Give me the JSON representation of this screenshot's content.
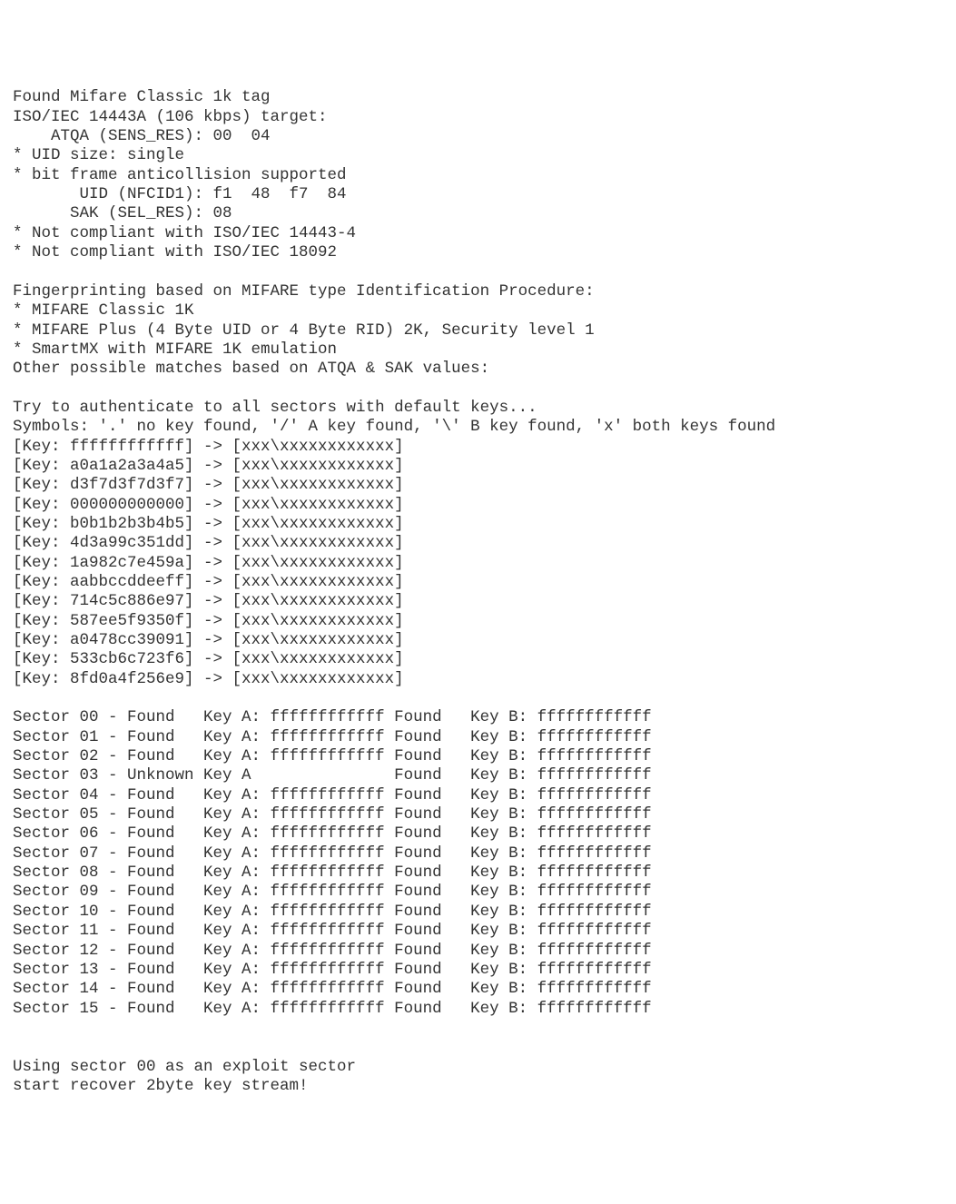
{
  "header": {
    "found_line": "Found Mifare Classic 1k tag",
    "iso_target": "ISO/IEC 14443A (106 kbps) target:",
    "atqa": "    ATQA (SENS_RES): 00  04",
    "uid_size": "* UID size: single",
    "bit_frame": "* bit frame anticollision supported",
    "uid": "       UID (NFCID1): f1  48  f7  84",
    "sak": "      SAK (SEL_RES): 08",
    "not_compliant_1": "* Not compliant with ISO/IEC 14443-4",
    "not_compliant_2": "* Not compliant with ISO/IEC 18092"
  },
  "fingerprint": {
    "title": "Fingerprinting based on MIFARE type Identification Procedure:",
    "item1": "* MIFARE Classic 1K",
    "item2": "* MIFARE Plus (4 Byte UID or 4 Byte RID) 2K, Security level 1",
    "item3": "* SmartMX with MIFARE 1K emulation",
    "other": "Other possible matches based on ATQA & SAK values:"
  },
  "auth": {
    "try_line": "Try to authenticate to all sectors with default keys...",
    "symbols": "Symbols: '.' no key found, '/' A key found, '\\' B key found, 'x' both keys found"
  },
  "keys": [
    "[Key: ffffffffffff] -> [xxx\\xxxxxxxxxxxx]",
    "[Key: a0a1a2a3a4a5] -> [xxx\\xxxxxxxxxxxx]",
    "[Key: d3f7d3f7d3f7] -> [xxx\\xxxxxxxxxxxx]",
    "[Key: 000000000000] -> [xxx\\xxxxxxxxxxxx]",
    "[Key: b0b1b2b3b4b5] -> [xxx\\xxxxxxxxxxxx]",
    "[Key: 4d3a99c351dd] -> [xxx\\xxxxxxxxxxxx]",
    "[Key: 1a982c7e459a] -> [xxx\\xxxxxxxxxxxx]",
    "[Key: aabbccddeeff] -> [xxx\\xxxxxxxxxxxx]",
    "[Key: 714c5c886e97] -> [xxx\\xxxxxxxxxxxx]",
    "[Key: 587ee5f9350f] -> [xxx\\xxxxxxxxxxxx]",
    "[Key: a0478cc39091] -> [xxx\\xxxxxxxxxxxx]",
    "[Key: 533cb6c723f6] -> [xxx\\xxxxxxxxxxxx]",
    "[Key: 8fd0a4f256e9] -> [xxx\\xxxxxxxxxxxx]"
  ],
  "sectors": [
    "Sector 00 - Found   Key A: ffffffffffff Found   Key B: ffffffffffff",
    "Sector 01 - Found   Key A: ffffffffffff Found   Key B: ffffffffffff",
    "Sector 02 - Found   Key A: ffffffffffff Found   Key B: ffffffffffff",
    "Sector 03 - Unknown Key A               Found   Key B: ffffffffffff",
    "Sector 04 - Found   Key A: ffffffffffff Found   Key B: ffffffffffff",
    "Sector 05 - Found   Key A: ffffffffffff Found   Key B: ffffffffffff",
    "Sector 06 - Found   Key A: ffffffffffff Found   Key B: ffffffffffff",
    "Sector 07 - Found   Key A: ffffffffffff Found   Key B: ffffffffffff",
    "Sector 08 - Found   Key A: ffffffffffff Found   Key B: ffffffffffff",
    "Sector 09 - Found   Key A: ffffffffffff Found   Key B: ffffffffffff",
    "Sector 10 - Found   Key A: ffffffffffff Found   Key B: ffffffffffff",
    "Sector 11 - Found   Key A: ffffffffffff Found   Key B: ffffffffffff",
    "Sector 12 - Found   Key A: ffffffffffff Found   Key B: ffffffffffff",
    "Sector 13 - Found   Key A: ffffffffffff Found   Key B: ffffffffffff",
    "Sector 14 - Found   Key A: ffffffffffff Found   Key B: ffffffffffff",
    "Sector 15 - Found   Key A: ffffffffffff Found   Key B: ffffffffffff"
  ],
  "footer": {
    "exploit": "Using sector 00 as an exploit sector",
    "recover": "start recover 2byte key stream!"
  }
}
